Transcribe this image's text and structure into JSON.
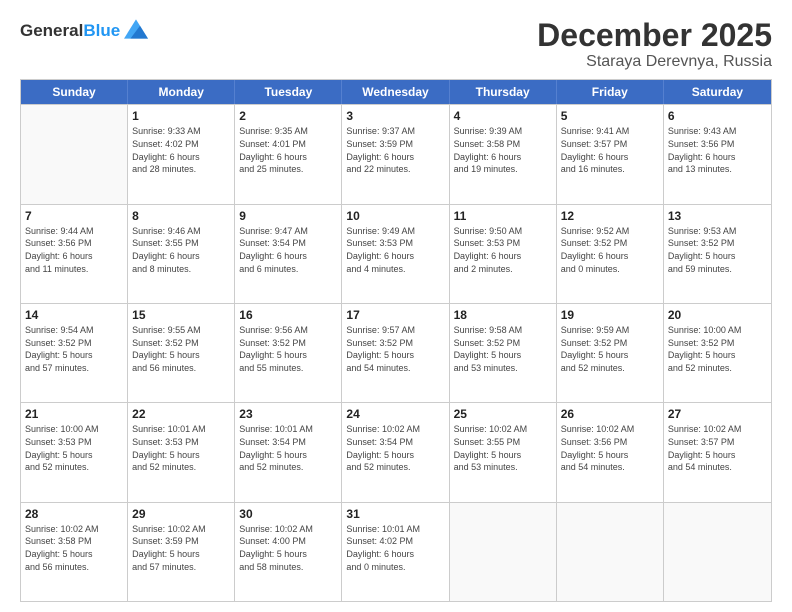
{
  "logo": {
    "line1": "General",
    "line2": "Blue"
  },
  "title": "December 2025",
  "subtitle": "Staraya Derevnya, Russia",
  "days": [
    "Sunday",
    "Monday",
    "Tuesday",
    "Wednesday",
    "Thursday",
    "Friday",
    "Saturday"
  ],
  "rows": [
    [
      {
        "day": "",
        "info": ""
      },
      {
        "day": "1",
        "info": "Sunrise: 9:33 AM\nSunset: 4:02 PM\nDaylight: 6 hours\nand 28 minutes."
      },
      {
        "day": "2",
        "info": "Sunrise: 9:35 AM\nSunset: 4:01 PM\nDaylight: 6 hours\nand 25 minutes."
      },
      {
        "day": "3",
        "info": "Sunrise: 9:37 AM\nSunset: 3:59 PM\nDaylight: 6 hours\nand 22 minutes."
      },
      {
        "day": "4",
        "info": "Sunrise: 9:39 AM\nSunset: 3:58 PM\nDaylight: 6 hours\nand 19 minutes."
      },
      {
        "day": "5",
        "info": "Sunrise: 9:41 AM\nSunset: 3:57 PM\nDaylight: 6 hours\nand 16 minutes."
      },
      {
        "day": "6",
        "info": "Sunrise: 9:43 AM\nSunset: 3:56 PM\nDaylight: 6 hours\nand 13 minutes."
      }
    ],
    [
      {
        "day": "7",
        "info": "Sunrise: 9:44 AM\nSunset: 3:56 PM\nDaylight: 6 hours\nand 11 minutes."
      },
      {
        "day": "8",
        "info": "Sunrise: 9:46 AM\nSunset: 3:55 PM\nDaylight: 6 hours\nand 8 minutes."
      },
      {
        "day": "9",
        "info": "Sunrise: 9:47 AM\nSunset: 3:54 PM\nDaylight: 6 hours\nand 6 minutes."
      },
      {
        "day": "10",
        "info": "Sunrise: 9:49 AM\nSunset: 3:53 PM\nDaylight: 6 hours\nand 4 minutes."
      },
      {
        "day": "11",
        "info": "Sunrise: 9:50 AM\nSunset: 3:53 PM\nDaylight: 6 hours\nand 2 minutes."
      },
      {
        "day": "12",
        "info": "Sunrise: 9:52 AM\nSunset: 3:52 PM\nDaylight: 6 hours\nand 0 minutes."
      },
      {
        "day": "13",
        "info": "Sunrise: 9:53 AM\nSunset: 3:52 PM\nDaylight: 5 hours\nand 59 minutes."
      }
    ],
    [
      {
        "day": "14",
        "info": "Sunrise: 9:54 AM\nSunset: 3:52 PM\nDaylight: 5 hours\nand 57 minutes."
      },
      {
        "day": "15",
        "info": "Sunrise: 9:55 AM\nSunset: 3:52 PM\nDaylight: 5 hours\nand 56 minutes."
      },
      {
        "day": "16",
        "info": "Sunrise: 9:56 AM\nSunset: 3:52 PM\nDaylight: 5 hours\nand 55 minutes."
      },
      {
        "day": "17",
        "info": "Sunrise: 9:57 AM\nSunset: 3:52 PM\nDaylight: 5 hours\nand 54 minutes."
      },
      {
        "day": "18",
        "info": "Sunrise: 9:58 AM\nSunset: 3:52 PM\nDaylight: 5 hours\nand 53 minutes."
      },
      {
        "day": "19",
        "info": "Sunrise: 9:59 AM\nSunset: 3:52 PM\nDaylight: 5 hours\nand 52 minutes."
      },
      {
        "day": "20",
        "info": "Sunrise: 10:00 AM\nSunset: 3:52 PM\nDaylight: 5 hours\nand 52 minutes."
      }
    ],
    [
      {
        "day": "21",
        "info": "Sunrise: 10:00 AM\nSunset: 3:53 PM\nDaylight: 5 hours\nand 52 minutes."
      },
      {
        "day": "22",
        "info": "Sunrise: 10:01 AM\nSunset: 3:53 PM\nDaylight: 5 hours\nand 52 minutes."
      },
      {
        "day": "23",
        "info": "Sunrise: 10:01 AM\nSunset: 3:54 PM\nDaylight: 5 hours\nand 52 minutes."
      },
      {
        "day": "24",
        "info": "Sunrise: 10:02 AM\nSunset: 3:54 PM\nDaylight: 5 hours\nand 52 minutes."
      },
      {
        "day": "25",
        "info": "Sunrise: 10:02 AM\nSunset: 3:55 PM\nDaylight: 5 hours\nand 53 minutes."
      },
      {
        "day": "26",
        "info": "Sunrise: 10:02 AM\nSunset: 3:56 PM\nDaylight: 5 hours\nand 54 minutes."
      },
      {
        "day": "27",
        "info": "Sunrise: 10:02 AM\nSunset: 3:57 PM\nDaylight: 5 hours\nand 54 minutes."
      }
    ],
    [
      {
        "day": "28",
        "info": "Sunrise: 10:02 AM\nSunset: 3:58 PM\nDaylight: 5 hours\nand 56 minutes."
      },
      {
        "day": "29",
        "info": "Sunrise: 10:02 AM\nSunset: 3:59 PM\nDaylight: 5 hours\nand 57 minutes."
      },
      {
        "day": "30",
        "info": "Sunrise: 10:02 AM\nSunset: 4:00 PM\nDaylight: 5 hours\nand 58 minutes."
      },
      {
        "day": "31",
        "info": "Sunrise: 10:01 AM\nSunset: 4:02 PM\nDaylight: 6 hours\nand 0 minutes."
      },
      {
        "day": "",
        "info": ""
      },
      {
        "day": "",
        "info": ""
      },
      {
        "day": "",
        "info": ""
      }
    ]
  ]
}
